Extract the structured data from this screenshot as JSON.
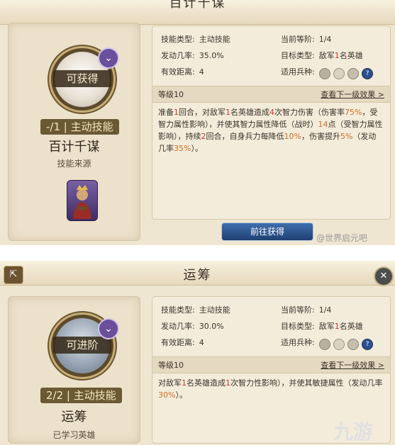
{
  "panel1": {
    "title": "百计千谋",
    "circle_label": "可获得",
    "level_text": "-/1 | 主动技能",
    "skill_name": "百计千谋",
    "source_label": "技能来源",
    "stats": {
      "skill_type_label": "技能类型:",
      "skill_type_value": "主动技能",
      "tier_label": "当前等阶:",
      "tier_value": "1/4",
      "chance_label": "发动几率:",
      "chance_value": "35.0%",
      "target_label": "目标类型:",
      "target_value_a": "敌军",
      "target_value_num": "1",
      "target_value_b": "名英雄",
      "range_label": "有效距离:",
      "range_value": "4",
      "unit_label": "适用兵种:",
      "unit_icons": [
        "gauntlet-icon",
        "shield-icon",
        "horse-icon",
        "question-icon"
      ]
    },
    "level_title": "等级10",
    "next_level_link": "查看下一级效果 >",
    "description": [
      {
        "t": "准备"
      },
      {
        "t": "1",
        "c": "red"
      },
      {
        "t": "回合，对敌军"
      },
      {
        "t": "1",
        "c": "red"
      },
      {
        "t": "名英雄造成"
      },
      {
        "t": "4",
        "c": "red"
      },
      {
        "t": "次智力伤害（伤害率"
      },
      {
        "t": "75%",
        "c": "orange"
      },
      {
        "t": "，受智力属性影响），并使其智力属性降低（战时）"
      },
      {
        "t": "14",
        "c": "orange"
      },
      {
        "t": "点（受智力属性影响），持续"
      },
      {
        "t": "2",
        "c": "red"
      },
      {
        "t": "回合，自身兵力每降低"
      },
      {
        "t": "10%",
        "c": "orange"
      },
      {
        "t": "，伤害提升"
      },
      {
        "t": "5%",
        "c": "orange"
      },
      {
        "t": "（发动几率"
      },
      {
        "t": "35%",
        "c": "orange"
      },
      {
        "t": "）。"
      }
    ],
    "go_button": "前往获得",
    "watermark": "@世界启元吧"
  },
  "panel2": {
    "title": "运筹",
    "circle_label": "可进阶",
    "level_text": "2/2 | 主动技能",
    "skill_name": "运筹",
    "source_label": "已学习英雄",
    "stats": {
      "skill_type_label": "技能类型:",
      "skill_type_value": "主动技能",
      "tier_label": "当前等阶:",
      "tier_value": "1/4",
      "chance_label": "发动几率:",
      "chance_value": "30.0%",
      "target_label": "目标类型:",
      "target_value_a": "敌军",
      "target_value_num": "1",
      "target_value_b": "名英雄",
      "range_label": "有效距离:",
      "range_value": "4",
      "unit_label": "适用兵种:",
      "unit_icons": [
        "gauntlet-icon",
        "shield-icon",
        "horse-icon",
        "question-icon"
      ]
    },
    "level_title": "等级10",
    "next_level_link": "查看下一级效果 >",
    "description": [
      {
        "t": "对敌军"
      },
      {
        "t": "1",
        "c": "red"
      },
      {
        "t": "名英雄造成"
      },
      {
        "t": "1",
        "c": "red"
      },
      {
        "t": "次智力"
      },
      {
        "t": "性影响），并使其敏捷属性"
      },
      {
        "t": "（发动几率"
      },
      {
        "t": "30%",
        "c": "orange"
      },
      {
        "t": "）。"
      }
    ],
    "watermark": "九游"
  },
  "colors": {
    "panel_bg": "#efe6d2",
    "accent_red": "#c9362c",
    "accent_orange": "#cf6f1f",
    "button_blue": "#2f5590",
    "badge_purple": "#6a4f9c"
  }
}
